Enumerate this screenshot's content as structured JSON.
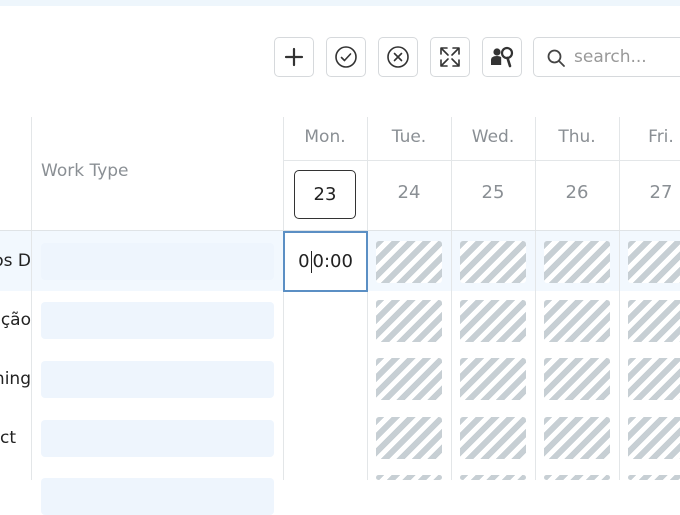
{
  "toolbar": {
    "add_icon": "plus-icon",
    "approve_icon": "check-circle-icon",
    "reject_icon": "x-circle-icon",
    "expand_icon": "expand-icon",
    "filter_icon": "people-search-icon",
    "search_placeholder": "search..."
  },
  "columns": {
    "work_type_header": "Work Type",
    "days": [
      {
        "name": "Mon.",
        "date": "23"
      },
      {
        "name": "Tue.",
        "date": "24"
      },
      {
        "name": "Wed.",
        "date": "25"
      },
      {
        "name": "Thu.",
        "date": "26"
      },
      {
        "name": "Fri.",
        "date": "27"
      }
    ]
  },
  "rows": [
    {
      "project": "os D"
    },
    {
      "project": "ição"
    },
    {
      "project": "hing"
    },
    {
      "project": "ct"
    }
  ],
  "editing_cell": {
    "before_caret": "0",
    "after_caret": "0:00"
  },
  "colors": {
    "accent": "#5b8fc4",
    "row_highlight": "#f2f8fe",
    "stripe": "#c7cfd4"
  }
}
